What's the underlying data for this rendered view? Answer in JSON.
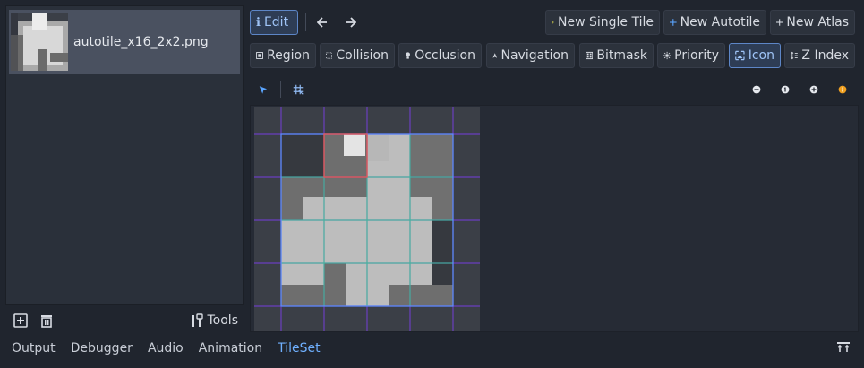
{
  "left_panel": {
    "textures": [
      {
        "name": "autotile_x16_2x2.png",
        "selected": true
      }
    ],
    "toolbar": {
      "add_icon": "add-texture-icon",
      "remove_icon": "trash-icon",
      "tools_label": "Tools"
    }
  },
  "toolbar": {
    "edit_label": "Edit",
    "new_single_tile_label": "New Single Tile",
    "new_autotile_label": "New Autotile",
    "new_atlas_label": "New Atlas"
  },
  "modes": [
    {
      "key": "region",
      "label": "Region",
      "icon": "region-icon"
    },
    {
      "key": "collision",
      "label": "Collision",
      "icon": "collision-icon"
    },
    {
      "key": "occlusion",
      "label": "Occlusion",
      "icon": "occlusion-icon"
    },
    {
      "key": "navigation",
      "label": "Navigation",
      "icon": "navigation-icon"
    },
    {
      "key": "bitmask",
      "label": "Bitmask",
      "icon": "bitmask-icon"
    },
    {
      "key": "priority",
      "label": "Priority",
      "icon": "priority-icon"
    },
    {
      "key": "icon",
      "label": "Icon",
      "icon": "icon-mode-icon",
      "active": true
    },
    {
      "key": "z_index",
      "label": "Z Index",
      "icon": "z-index-icon"
    }
  ],
  "editor_toolbar": {
    "select_tool": "pointer-icon",
    "grid_snap": "grid-snap-icon",
    "zoom_out": "zoom-out-icon",
    "zoom_reset": "zoom-reset-icon",
    "zoom_in": "zoom-in-icon",
    "info": "info-icon"
  },
  "colors": {
    "accent": "#6fb0ff",
    "active_mode_border": "#5d86c7",
    "new_single_tile_plus": "#f2e94e",
    "new_autotile_plus": "#5aa5ff",
    "tile_grid_line": "#3fbf9a",
    "region_outline": "#5b8fff",
    "subtile_grid": "#6a3fbf",
    "icon_selection": "#e05a5a"
  },
  "bottom_panel": {
    "tabs": [
      {
        "label": "Output"
      },
      {
        "label": "Debugger"
      },
      {
        "label": "Audio"
      },
      {
        "label": "Animation"
      },
      {
        "label": "TileSet",
        "active": true
      }
    ],
    "expand_icon": "expand-bottom-panel-icon"
  }
}
